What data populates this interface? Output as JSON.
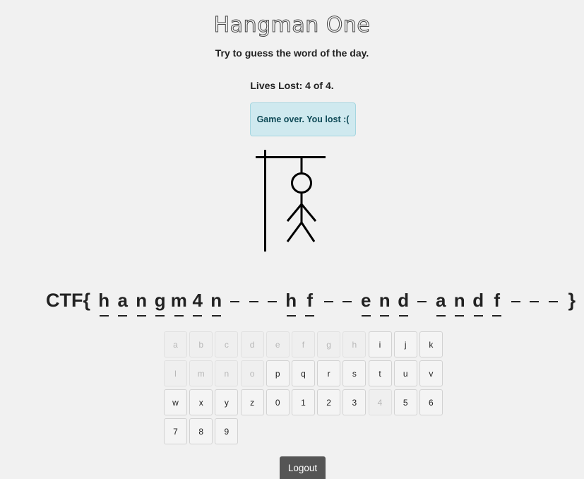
{
  "title": "Hangman One",
  "subtitle": "Try to guess the word of the day.",
  "lives": "Lives Lost: 4 of 4.",
  "alert": "Game over. You lost :(",
  "word": {
    "prefix": "CTF{",
    "suffix": "}",
    "slots": [
      "h",
      "a",
      "n",
      "g",
      "m",
      "4",
      "n",
      "",
      "",
      "",
      "h",
      "f",
      "",
      "",
      "e",
      "n",
      "d",
      "",
      "a",
      "n",
      "d",
      "f",
      "",
      "",
      ""
    ]
  },
  "keyboard": [
    {
      "label": "a",
      "disabled": true
    },
    {
      "label": "b",
      "disabled": true
    },
    {
      "label": "c",
      "disabled": true
    },
    {
      "label": "d",
      "disabled": true
    },
    {
      "label": "e",
      "disabled": true
    },
    {
      "label": "f",
      "disabled": true
    },
    {
      "label": "g",
      "disabled": true
    },
    {
      "label": "h",
      "disabled": true
    },
    {
      "label": "i",
      "disabled": false
    },
    {
      "label": "j",
      "disabled": false
    },
    {
      "label": "k",
      "disabled": false
    },
    {
      "label": "l",
      "disabled": true
    },
    {
      "label": "m",
      "disabled": true
    },
    {
      "label": "n",
      "disabled": true
    },
    {
      "label": "o",
      "disabled": true
    },
    {
      "label": "p",
      "disabled": false
    },
    {
      "label": "q",
      "disabled": false
    },
    {
      "label": "r",
      "disabled": false
    },
    {
      "label": "s",
      "disabled": false
    },
    {
      "label": "t",
      "disabled": false
    },
    {
      "label": "u",
      "disabled": false
    },
    {
      "label": "v",
      "disabled": false
    },
    {
      "label": "w",
      "disabled": false
    },
    {
      "label": "x",
      "disabled": false
    },
    {
      "label": "y",
      "disabled": false
    },
    {
      "label": "z",
      "disabled": false
    },
    {
      "label": "0",
      "disabled": false
    },
    {
      "label": "1",
      "disabled": false
    },
    {
      "label": "2",
      "disabled": false
    },
    {
      "label": "3",
      "disabled": false
    },
    {
      "label": "4",
      "disabled": true
    },
    {
      "label": "5",
      "disabled": false
    },
    {
      "label": "6",
      "disabled": false
    },
    {
      "label": "7",
      "disabled": false
    },
    {
      "label": "8",
      "disabled": false
    },
    {
      "label": "9",
      "disabled": false
    }
  ],
  "logout_label": "Logout",
  "icons": {
    "hangman": "hangman-figure-icon"
  }
}
